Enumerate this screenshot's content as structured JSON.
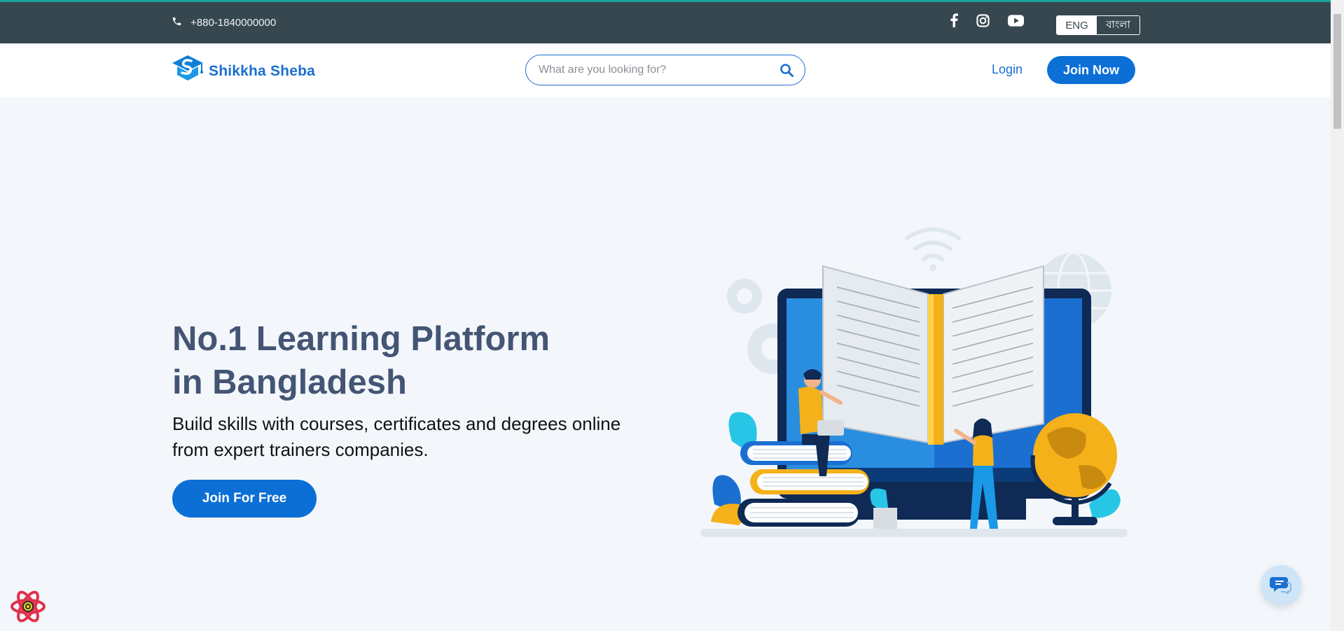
{
  "topbar": {
    "phone": "+880-1840000000",
    "social_icons": [
      "facebook-icon",
      "instagram-icon",
      "youtube-icon"
    ],
    "lang_options": [
      "ENG",
      "বাংলা"
    ],
    "lang_selected": "ENG"
  },
  "navbar": {
    "brand": "Shikkha Sheba",
    "search_placeholder": "What are you looking for?",
    "login_label": "Login",
    "join_label": "Join Now"
  },
  "hero": {
    "title_line1": "No.1 Learning Platform",
    "title_line2": "in Bangladesh",
    "subtitle_line1": "Build skills with courses, certificates and degrees online",
    "subtitle_line2": "from expert trainers companies.",
    "cta_label": "Join For Free"
  },
  "colors": {
    "topbar": "#37474f",
    "accent": "#0b6fd6",
    "hero_bg": "#f3f7fb",
    "title": "#445574"
  }
}
